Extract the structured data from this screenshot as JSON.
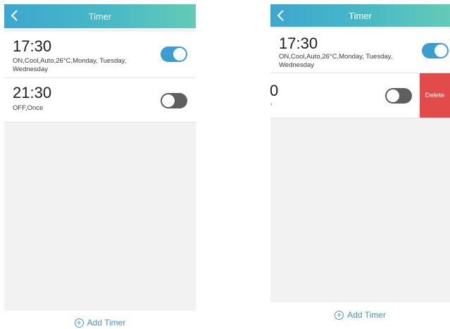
{
  "screens": [
    {
      "title": "Timer",
      "timers": [
        {
          "time": "17:30",
          "detail_line1": "ON,Cool,Auto,26°C,Monday, Tuesday,",
          "detail_line2": "Wednesday",
          "enabled": true
        },
        {
          "time": "21:30",
          "detail_line1": "OFF,Once",
          "detail_line2": "",
          "enabled": false
        }
      ],
      "add_label": "Add Timer"
    },
    {
      "title": "Timer",
      "timers": [
        {
          "time": "17:30",
          "detail_line1": "ON,Cool,Auto,26°C,Monday, Tuesday,",
          "detail_line2": "Wednesday",
          "enabled": true
        },
        {
          "time_fragment": "0",
          "detail_fragment": ",",
          "enabled": false,
          "action_label": "Delete"
        }
      ],
      "add_label": "Add Timer"
    }
  ],
  "colors": {
    "header_gradient": [
      "#3da7cf",
      "#64cbb7"
    ],
    "toggle_on": "#3a9ed2",
    "toggle_off": "#5f5f5f",
    "delete": "#e34a4a",
    "accent_text": "#4a8fc5",
    "background": "#f2f2f3"
  },
  "icons": {
    "back": "chevron-left-icon",
    "add": "plus-circle-icon"
  }
}
